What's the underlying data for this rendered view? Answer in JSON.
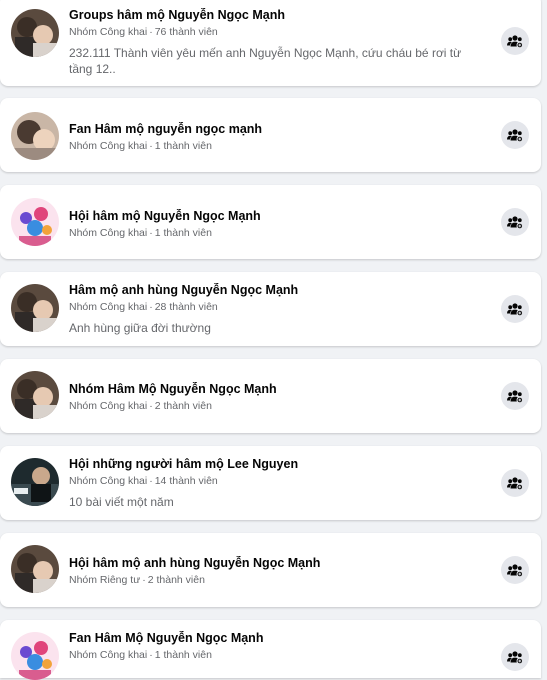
{
  "colors": {
    "background": "#f0f2f5",
    "card": "#ffffff",
    "title_text": "#050505",
    "meta_text": "#65676b",
    "button_bg": "#e4e6eb"
  },
  "icons": {
    "join": "group-join-icon",
    "avatar": "group-avatar-image"
  },
  "groups": [
    {
      "name": "Groups hâm mộ Nguyễn Ngọc Mạnh",
      "privacy": "Nhóm Công khai",
      "members": "76 thành viên",
      "description": "232.111 Thành viên yêu mến anh Nguyễn Ngọc Mạnh, cứu cháu bé rơi từ tầng 12.."
    },
    {
      "name": "Fan Hâm mộ nguyễn ngọc mạnh",
      "privacy": "Nhóm Công khai",
      "members": "1 thành viên",
      "description": ""
    },
    {
      "name": "Hội hâm mộ Nguyễn Ngọc Mạnh",
      "privacy": "Nhóm Công khai",
      "members": "1 thành viên",
      "description": ""
    },
    {
      "name": "Hâm mộ anh hùng Nguyễn Ngọc Mạnh",
      "privacy": "Nhóm Công khai",
      "members": "28 thành viên",
      "description": "Anh hùng giữa đời thường"
    },
    {
      "name": "Nhóm Hâm Mộ Nguyễn Ngọc Mạnh",
      "privacy": "Nhóm Công khai",
      "members": "2 thành viên",
      "description": ""
    },
    {
      "name": "Hội những người hâm mộ Lee Nguyen",
      "privacy": "Nhóm Công khai",
      "members": "14 thành viên",
      "description": "10 bài viết một năm"
    },
    {
      "name": "Hội hâm mộ anh hùng Nguyễn Ngọc Mạnh",
      "privacy": "Nhóm Riêng tư",
      "members": "2 thành viên",
      "description": ""
    },
    {
      "name": "Fan Hâm Mộ Nguyễn Ngọc Mạnh",
      "privacy": "Nhóm Công khai",
      "members": "1 thành viên",
      "description": ""
    }
  ]
}
